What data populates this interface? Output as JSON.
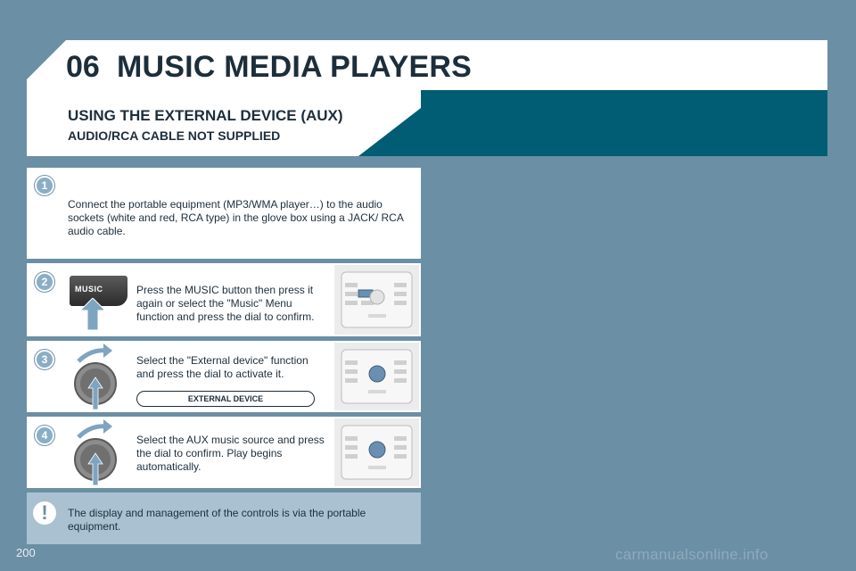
{
  "header": {
    "chapter_number": "06",
    "title": "MUSIC MEDIA PLAYERS"
  },
  "section": {
    "title": "USING THE EXTERNAL DEVICE (AUX)",
    "subtitle": "AUDIO/RCA CABLE NOT SUPPLIED"
  },
  "steps": [
    {
      "number": "1",
      "text": "Connect the portable equipment (MP3/WMA player…) to the audio sockets (white and red, RCA type) in the glove box using a JACK/ RCA audio cable."
    },
    {
      "number": "2",
      "text": "Press the MUSIC button then press it again or select the \"Music\" Menu function and press the dial to confirm.",
      "button_label": "MUSIC"
    },
    {
      "number": "3",
      "text": "Select the \"External device\" function and press the dial to activate it.",
      "display_label": "EXTERNAL DEVICE"
    },
    {
      "number": "4",
      "text": "Select the AUX music source and press the dial to confirm. Play begins automatically."
    }
  ],
  "note": {
    "icon": "exclamation-icon",
    "symbol": "!",
    "text": "The display and management of the controls is via the portable equipment."
  },
  "footer": {
    "page_number": "200",
    "watermark": "carmanualsonline.info"
  },
  "colors": {
    "background": "#6b8fa5",
    "teal_band": "#005d73",
    "note_panel": "#a9c1d1",
    "badge": "#8aaec6",
    "text": "#1d2e3b"
  }
}
